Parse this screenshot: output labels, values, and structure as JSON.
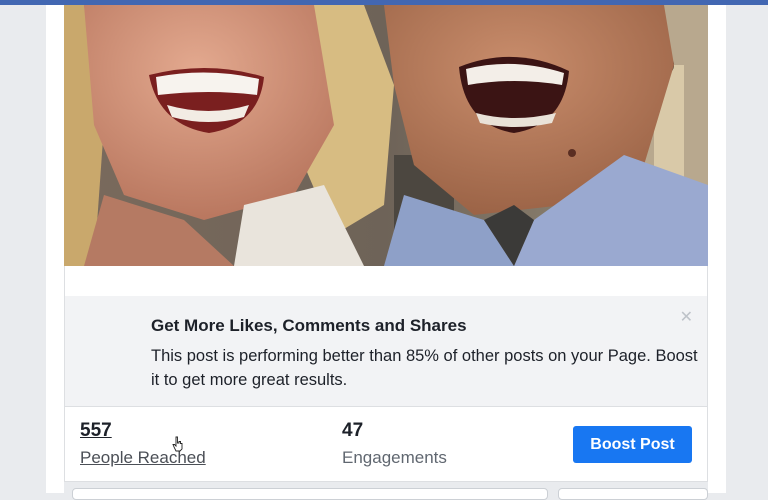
{
  "post": {
    "photo_icon": "selfie-photo"
  },
  "boost_banner": {
    "title": "Get More Likes, Comments and Shares",
    "body": "This post is performing better than 85% of other posts on your Page. Boost it to get more great results.",
    "close_icon": "close-icon"
  },
  "stats": {
    "people_reached_value": "557",
    "people_reached_label": "People Reached",
    "engagements_value": "47",
    "engagements_label": "Engagements"
  },
  "actions": {
    "boost_label": "Boost Post"
  },
  "colors": {
    "brand_blue": "#4267b2",
    "button_blue": "#1877f2",
    "banner_bg": "#f2f3f5",
    "page_bg": "#e9ebee"
  }
}
